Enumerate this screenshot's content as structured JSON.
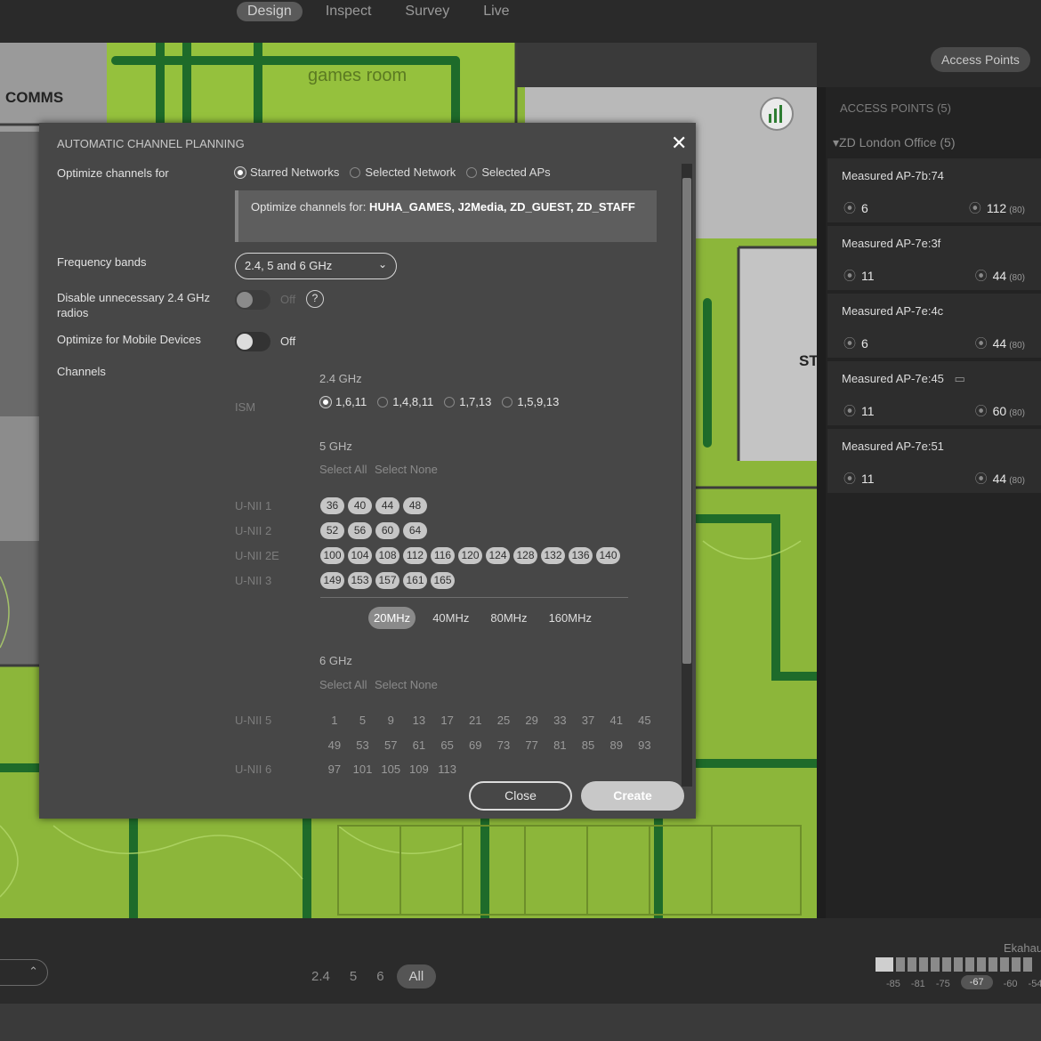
{
  "topnav": {
    "tabs": [
      "Design",
      "Inspect",
      "Survey",
      "Live"
    ],
    "active": "Design"
  },
  "map": {
    "labels": {
      "comms": "COMMS",
      "games_room": "games room",
      "st": "ST"
    }
  },
  "right": {
    "access_points_button": "Access Points",
    "panel_title": "ACCESS POINTS (5)",
    "group": "▾ZD London Office (5)",
    "aps": [
      {
        "name": "Measured AP-7b:74",
        "channel": "6",
        "value": "112",
        "unit": "(80)"
      },
      {
        "name": "Measured AP-7e:3f",
        "channel": "11",
        "value": "44",
        "unit": "(80)"
      },
      {
        "name": "Measured AP-7e:4c",
        "channel": "6",
        "value": "44",
        "unit": "(80)"
      },
      {
        "name": "Measured AP-7e:45",
        "channel": "11",
        "value": "60",
        "unit": "(80)"
      },
      {
        "name": "Measured AP-7e:51",
        "channel": "11",
        "value": "44",
        "unit": "(80)"
      }
    ]
  },
  "modal": {
    "title": "AUTOMATIC CHANNEL PLANNING",
    "close_glyph": "✕",
    "optimize_for_label": "Optimize channels for",
    "radio_options": [
      "Starred Networks",
      "Selected Network",
      "Selected APs"
    ],
    "radio_selected": "Starred Networks",
    "info_prefix": "Optimize channels for: ",
    "info_networks": "HUHA_GAMES, J2Media, ZD_GUEST, ZD_STAFF",
    "frequency_label": "Frequency bands",
    "frequency_value": "2.4, 5 and 6 GHz",
    "disable_24_label": "Disable unnecessary 2.4 GHz radios",
    "disable_24_state": "Off",
    "mobile_label": "Optimize for Mobile Devices",
    "mobile_state": "Off",
    "channels_label": "Channels",
    "band_24": "2.4 GHz",
    "ism_label": "ISM",
    "ism_options": [
      "1,6,11",
      "1,4,8,11",
      "1,7,13",
      "1,5,9,13"
    ],
    "ism_selected": "1,6,11",
    "band_5": "5 GHz",
    "select_all": "Select All",
    "select_none": "Select None",
    "unii_rows": [
      {
        "label": "U-NII 1",
        "channels": [
          "36",
          "40",
          "44",
          "48"
        ]
      },
      {
        "label": "U-NII 2",
        "channels": [
          "52",
          "56",
          "60",
          "64"
        ]
      },
      {
        "label": "U-NII 2E",
        "channels": [
          "100",
          "104",
          "108",
          "112",
          "116",
          "120",
          "124",
          "128",
          "132",
          "136",
          "140"
        ]
      },
      {
        "label": "U-NII 3",
        "channels": [
          "149",
          "153",
          "157",
          "161",
          "165"
        ]
      }
    ],
    "widths": [
      "20MHz",
      "40MHz",
      "80MHz",
      "160MHz"
    ],
    "width_selected": "20MHz",
    "band_6": "6 GHz",
    "unii5_label": "U-NII 5",
    "unii6_label": "U-NII 6",
    "six_ghz_rows": [
      [
        "1",
        "5",
        "9",
        "13",
        "17",
        "21",
        "25",
        "29",
        "33",
        "37",
        "41",
        "45"
      ],
      [
        "49",
        "53",
        "57",
        "61",
        "65",
        "69",
        "73",
        "77",
        "81",
        "85",
        "89",
        "93"
      ],
      [
        "97",
        "101",
        "105",
        "109",
        "113"
      ]
    ],
    "close_button": "Close",
    "create_button": "Create"
  },
  "bottom": {
    "band_filters": [
      "2.4",
      "5",
      "6",
      "All"
    ],
    "band_selected": "All",
    "legend_title": "Ekahau",
    "legend_ticks": [
      "-85",
      "-81",
      "-75",
      "-67",
      "-60",
      "-54"
    ],
    "legend_selected": "-67"
  }
}
